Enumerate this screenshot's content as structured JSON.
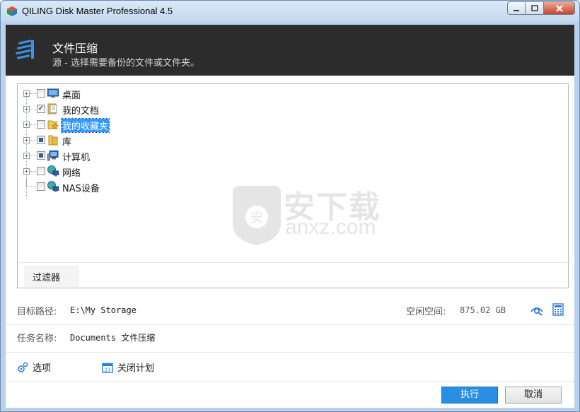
{
  "window": {
    "title": "QILING Disk Master Professional 4.5"
  },
  "header": {
    "title": "文件压缩",
    "subtitle": "源 - 选择需要备份的文件或文件夹。"
  },
  "tree": [
    {
      "label": "桌面",
      "checked": false,
      "icon": "desktop-icon"
    },
    {
      "label": "我的文档",
      "checked": true,
      "icon": "documents-folder-icon"
    },
    {
      "label": "我的收藏夹",
      "checked": false,
      "icon": "favorites-folder-icon",
      "selected": true
    },
    {
      "label": "库",
      "checked": "partial",
      "icon": "library-folder-icon"
    },
    {
      "label": "计算机",
      "checked": "partial",
      "icon": "computer-icon"
    },
    {
      "label": "网络",
      "checked": false,
      "icon": "network-icon"
    },
    {
      "label": "NAS设备",
      "checked": false,
      "icon": "nas-device-icon"
    }
  ],
  "filter_tab": "过滤器",
  "target": {
    "label": "目标路径:",
    "value": "E:\\My Storage"
  },
  "free_space": {
    "label": "空闲空间:",
    "value": "875.02 GB"
  },
  "task": {
    "label": "任务名称:",
    "value": "Documents 文件压缩"
  },
  "options_link": "选项",
  "schedule_link": "关闭计划",
  "buttons": {
    "run": "执行",
    "cancel": "取消"
  },
  "watermark": {
    "brand": "安下载",
    "domain": "anxz.com"
  },
  "colors": {
    "header_bg": "#2c2c2c",
    "primary_button": "#2a8fe4",
    "selection": "#3399ff"
  }
}
